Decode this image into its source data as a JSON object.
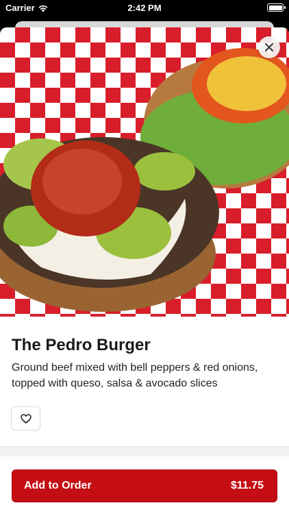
{
  "status_bar": {
    "carrier": "Carrier",
    "time": "2:42 PM"
  },
  "item": {
    "name": "The Pedro Burger",
    "description": "Ground beef mixed with bell peppers & red onions, topped with queso, salsa & avocado slices"
  },
  "order": {
    "add_label": "Add to Order",
    "price": "$11.75"
  },
  "colors": {
    "brand_red": "#c40e14",
    "checker_red": "#d81e2a"
  },
  "icons": {
    "close": "close-icon",
    "favorite": "heart-outline-icon"
  }
}
